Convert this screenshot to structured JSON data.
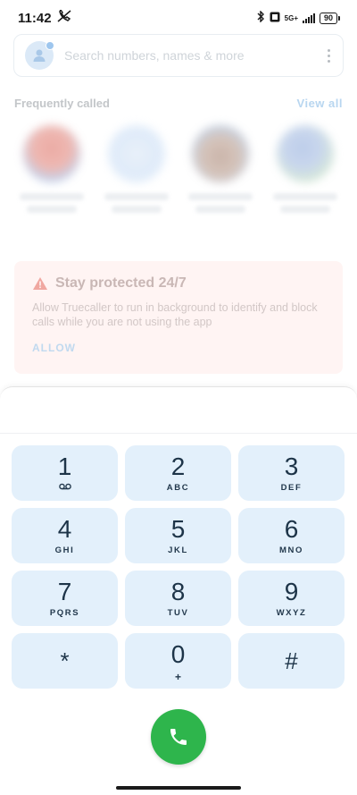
{
  "status_bar": {
    "time": "11:42",
    "network": "5G+",
    "battery": "90"
  },
  "search": {
    "placeholder": "Search numbers, names & more"
  },
  "frequently_called": {
    "title": "Frequently called",
    "view_all_label": "View all",
    "contacts": [
      {
        "avatar_color": "#e9a29a"
      },
      {
        "avatar_color": "#cfe0f6"
      },
      {
        "avatar_color": "#c9b2a6"
      },
      {
        "avatar_color": "#b7c9e8"
      }
    ]
  },
  "protection_card": {
    "title": "Stay protected 24/7",
    "body": "Allow Truecaller to run in background to identify and block calls while you are not using the app",
    "allow_label": "ALLOW",
    "warning_color": "#f0a7a0"
  },
  "dialpad": {
    "keys": [
      {
        "digit": "1",
        "letters": ""
      },
      {
        "digit": "2",
        "letters": "ABC"
      },
      {
        "digit": "3",
        "letters": "DEF"
      },
      {
        "digit": "4",
        "letters": "GHI"
      },
      {
        "digit": "5",
        "letters": "JKL"
      },
      {
        "digit": "6",
        "letters": "MNO"
      },
      {
        "digit": "7",
        "letters": "PQRS"
      },
      {
        "digit": "8",
        "letters": "TUV"
      },
      {
        "digit": "9",
        "letters": "WXYZ"
      },
      {
        "digit": "*",
        "letters": ""
      },
      {
        "digit": "0",
        "letters": "+"
      },
      {
        "digit": "#",
        "letters": ""
      }
    ],
    "call_button_color": "#2eb54c"
  }
}
